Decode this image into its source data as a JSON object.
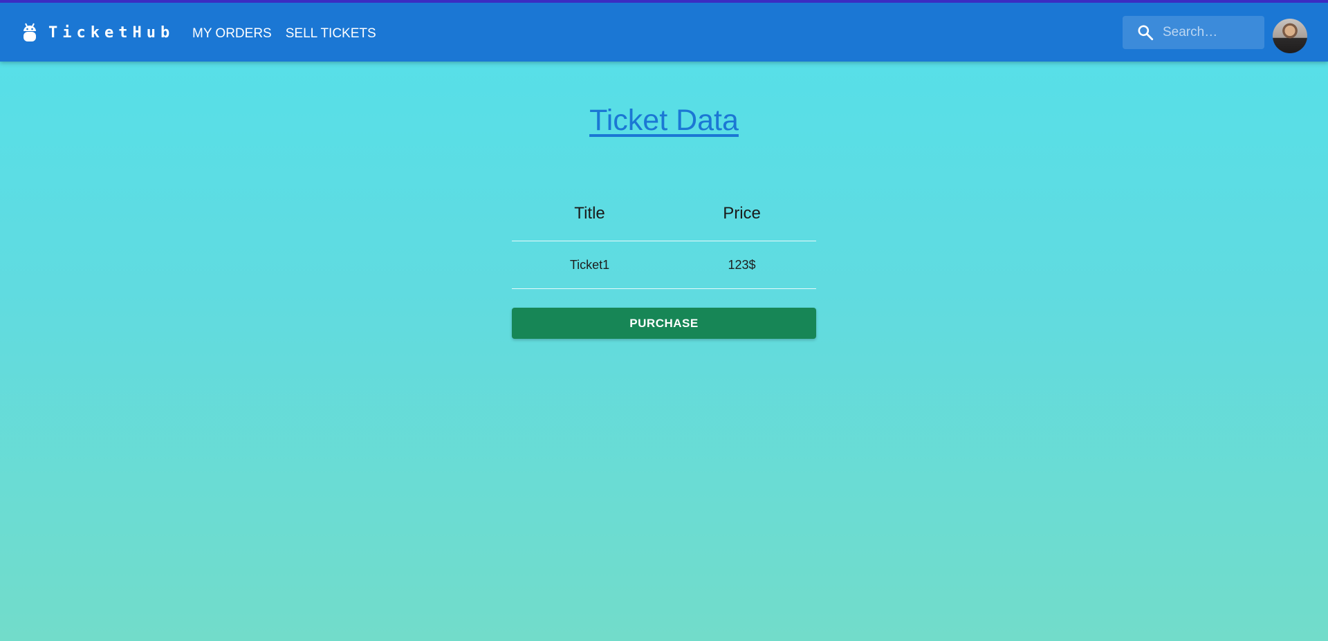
{
  "header": {
    "brand": "TicketHub",
    "brand_icon": "android-icon",
    "nav": [
      {
        "label": "MY ORDERS"
      },
      {
        "label": "SELL TICKETS"
      }
    ],
    "search": {
      "placeholder": "Search…",
      "value": "",
      "icon": "search-icon"
    },
    "avatar_icon": "user-avatar"
  },
  "main": {
    "title": "Ticket Data",
    "table": {
      "columns": [
        "Title",
        "Price"
      ],
      "rows": [
        [
          "Ticket1",
          "123$"
        ]
      ]
    },
    "purchase_label": "PURCHASE"
  },
  "colors": {
    "appbar": "#1b77d4",
    "appbar_top_border": "#3b2cc2",
    "purchase_button": "#178656",
    "title_link": "#1b77d4"
  }
}
